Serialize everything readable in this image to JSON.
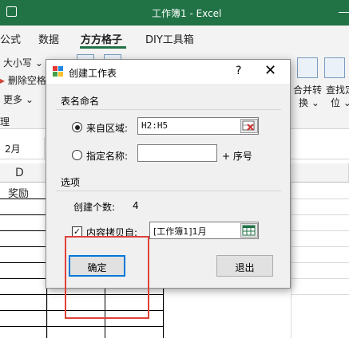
{
  "excel": {
    "title": "工作簿1  -  Excel",
    "tabs": [
      "公式",
      "数据",
      "方方格子",
      "DIY工具箱"
    ],
    "ribbon": {
      "size_label": "大小写",
      "delete_space_label": "删除空格",
      "more_label": "更多",
      "manage_label": "理",
      "merge_label": "合并转",
      "merge_label2": "换",
      "find_label": "查找定",
      "find_label2": "位"
    },
    "name_box": "2月",
    "columns": [
      "D"
    ],
    "cells": {
      "d1": "奖励"
    }
  },
  "dialog": {
    "title": "创建工作表",
    "help": "?",
    "close": "✕",
    "naming_group": "表名命名",
    "from_range_label": "来自区域:",
    "from_range_value": "H2:H5",
    "specify_name_label": "指定名称:",
    "specify_name_value": "",
    "plus_serial_label": "+ 序号",
    "options_group": "选项",
    "create_count_label": "创建个数:",
    "create_count_value": "4",
    "copy_from_label": "内容拷贝自:",
    "copy_from_value": "[工作簿1]1月",
    "ok_label": "确定",
    "exit_label": "退出"
  },
  "colors": {
    "excel_green": "#217346",
    "highlight_red": "#e0413a",
    "default_button_border": "#0078d7"
  }
}
